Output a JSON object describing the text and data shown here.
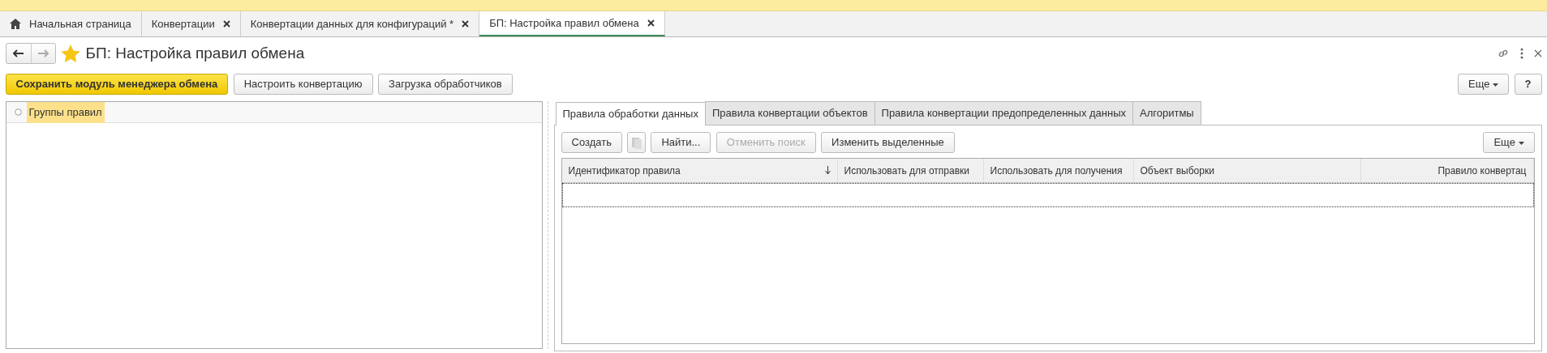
{
  "open_tabs": [
    {
      "label": "Начальная страница",
      "kind": "home",
      "closable": false,
      "selected": false
    },
    {
      "label": "Конвертации",
      "kind": "doc",
      "closable": true,
      "selected": false
    },
    {
      "label": "Конвертации данных для конфигураций *",
      "kind": "doc",
      "closable": true,
      "selected": false
    },
    {
      "label": "БП: Настройка правил обмена",
      "kind": "doc",
      "closable": true,
      "selected": true
    }
  ],
  "form": {
    "title": "БП: Настройка правил обмена",
    "favorite": true,
    "buttons": [
      {
        "label": "Сохранить модуль менеджера обмена",
        "kind": "primary"
      },
      {
        "label": "Настроить конвертацию",
        "kind": "normal"
      },
      {
        "label": "Загрузка обработчиков",
        "kind": "normal"
      }
    ],
    "more_button": "Еще",
    "help_button": "?"
  },
  "tree": {
    "items": [
      {
        "label": "Группы правил",
        "selected": true
      }
    ]
  },
  "tabs": [
    {
      "label": "Правила обработки данных",
      "selected": true
    },
    {
      "label": "Правила конвертации объектов",
      "selected": false
    },
    {
      "label": "Правила конвертации предопределенных данных",
      "selected": false
    },
    {
      "label": "Алгоритмы",
      "selected": false
    }
  ],
  "toolbar": {
    "buttons": [
      {
        "label": "Создать",
        "kind": "text",
        "disabled": false
      },
      {
        "kind": "icon",
        "disabled": true
      },
      {
        "label": "Найти...",
        "kind": "text",
        "disabled": false
      },
      {
        "label": "Отменить поиск",
        "kind": "text",
        "disabled": true
      },
      {
        "label": "Изменить выделенные",
        "kind": "text",
        "disabled": false
      }
    ],
    "more_button": "Еще"
  },
  "table": {
    "columns": [
      {
        "label": "Идентификатор правила",
        "sorted": true
      },
      {
        "label": "Использовать для отправки",
        "sorted": false
      },
      {
        "label": "Использовать для получения",
        "sorted": false
      },
      {
        "label": "Объект выборки",
        "sorted": false
      },
      {
        "label": "Правило конвертац",
        "sorted": false
      }
    ]
  }
}
